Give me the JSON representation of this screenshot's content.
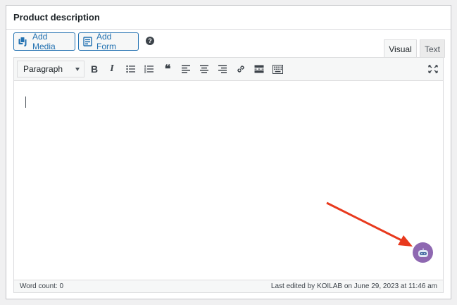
{
  "panel": {
    "title": "Product description"
  },
  "media_buttons": {
    "add_media_label": "Add Media",
    "add_form_label": "Add Form",
    "help_glyph": "?"
  },
  "tabs": {
    "visual": "Visual",
    "text": "Text",
    "active": "Visual"
  },
  "toolbar": {
    "format_selected": "Paragraph",
    "buttons": [
      "bold-icon",
      "italic-icon",
      "bulleted-list-icon",
      "numbered-list-icon",
      "blockquote-icon",
      "align-left-icon",
      "align-center-icon",
      "align-right-icon",
      "link-icon",
      "read-more-icon",
      "toolbar-toggle-icon",
      "fullscreen-icon"
    ],
    "bold_glyph": "B",
    "italic_glyph": "I",
    "quote_glyph": "❝"
  },
  "status": {
    "word_count": "Word count: 0",
    "last_edited": "Last edited by KOILAB on June 29, 2023 at 11:46 am"
  },
  "colors": {
    "accent": "#2271b1",
    "assistant": "#8e68b1",
    "annotation_arrow": "#e8391d"
  }
}
